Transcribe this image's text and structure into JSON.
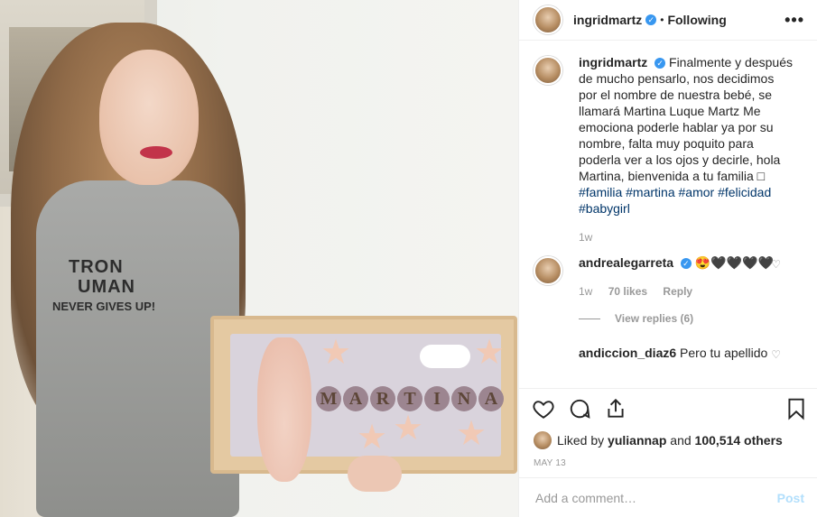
{
  "post_author": {
    "username": "ingridmartz",
    "follow_status": "Following",
    "more_icon": "more-horizontal-icon"
  },
  "photo": {
    "shirt_lines": [
      "TRON",
      "UMAN",
      "NEVER GIVES UP!"
    ],
    "sign_letters": [
      "M",
      "A",
      "R",
      "T",
      "I",
      "N",
      "A"
    ]
  },
  "caption": {
    "username": "ingridmartz",
    "text": "Finalmente y después de mucho pensarlo, nos decidimos por el nombre de nuestra bebé, se llamará Martina Luque Martz Me emociona poderle hablar ya por su nombre, falta muy poquito para poderla ver a los ojos y decirle, hola Martina, bienvenida a tu familia □",
    "tags": [
      "#familia",
      "#martina",
      "#amor",
      "#felicidad",
      "#babygirl"
    ],
    "time": "1w"
  },
  "comments": [
    {
      "username": "andrealegarreta",
      "text": "😍🖤🖤🖤🖤",
      "time": "1w",
      "likes": "70 likes",
      "reply_label": "Reply",
      "view_replies": "View replies (6)"
    },
    {
      "username": "andiccion_diaz6",
      "text": "Pero tu apellido"
    }
  ],
  "actions": {
    "like": "heart-icon",
    "comment": "comment-icon",
    "share": "share-icon",
    "save": "bookmark-icon"
  },
  "likes": {
    "prefix": "Liked by",
    "user": "yuliannap",
    "middle": "and",
    "count": "100,514 others"
  },
  "date": "MAY 13",
  "add_comment": {
    "placeholder": "Add a comment…",
    "post_label": "Post"
  },
  "colors": {
    "verified": "#3897f0",
    "hashtag": "#003569",
    "muted": "#999999",
    "post_disabled": "#b2dffc"
  }
}
